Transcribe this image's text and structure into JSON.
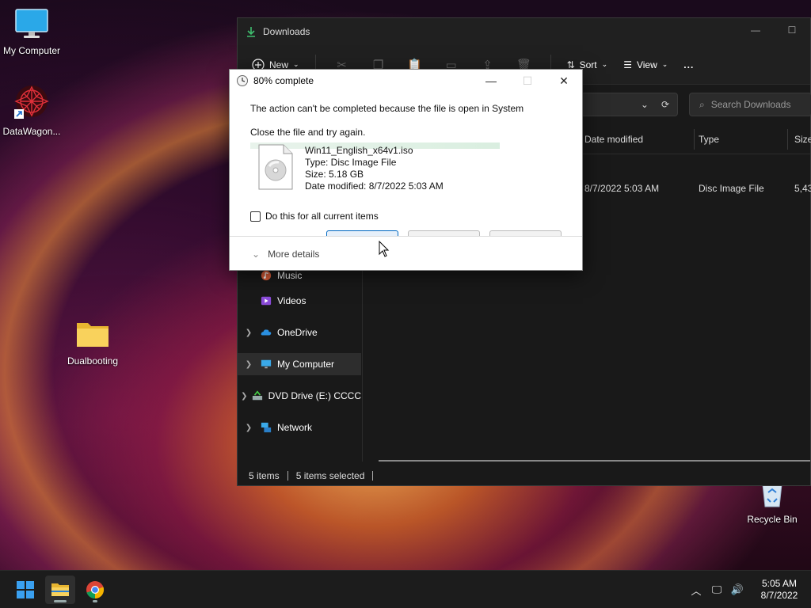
{
  "desktop": {
    "icons": [
      {
        "label": "My Computer"
      },
      {
        "label": "DataWagon..."
      },
      {
        "label": "Dualbooting"
      },
      {
        "label": "Recycle Bin"
      }
    ]
  },
  "explorer": {
    "title": "Downloads",
    "toolbar": {
      "new_label": "New",
      "sort_label": "Sort",
      "view_label": "View",
      "more_label": "..."
    },
    "search_placeholder": "Search Downloads",
    "columns": {
      "date_modified": "Date modified",
      "type": "Type",
      "size": "Size"
    },
    "row": {
      "date_modified": "8/7/2022 5:03 AM",
      "type": "Disc Image File",
      "size": "5,43"
    },
    "nav": [
      {
        "label": "Music"
      },
      {
        "label": "Videos"
      },
      {
        "label": "OneDrive"
      },
      {
        "label": "My Computer"
      },
      {
        "label": "DVD Drive (E:) CCCC"
      },
      {
        "label": "Network"
      }
    ],
    "status": {
      "items": "5 items",
      "selected": "5 items selected"
    }
  },
  "dialog": {
    "title": "80% complete",
    "progress": 0.8,
    "message": "The action can't be completed because the file is open in System",
    "instruction": "Close the file and try again.",
    "file": {
      "name": "Win11_English_x64v1.iso",
      "type": "Type: Disc Image File",
      "size": "Size: 5.18 GB",
      "date": "Date modified: 8/7/2022 5:03 AM"
    },
    "checkbox_label": "Do this for all current items",
    "more_details": "More details"
  },
  "taskbar": {
    "time": "5:05 AM",
    "date": "8/7/2022"
  }
}
